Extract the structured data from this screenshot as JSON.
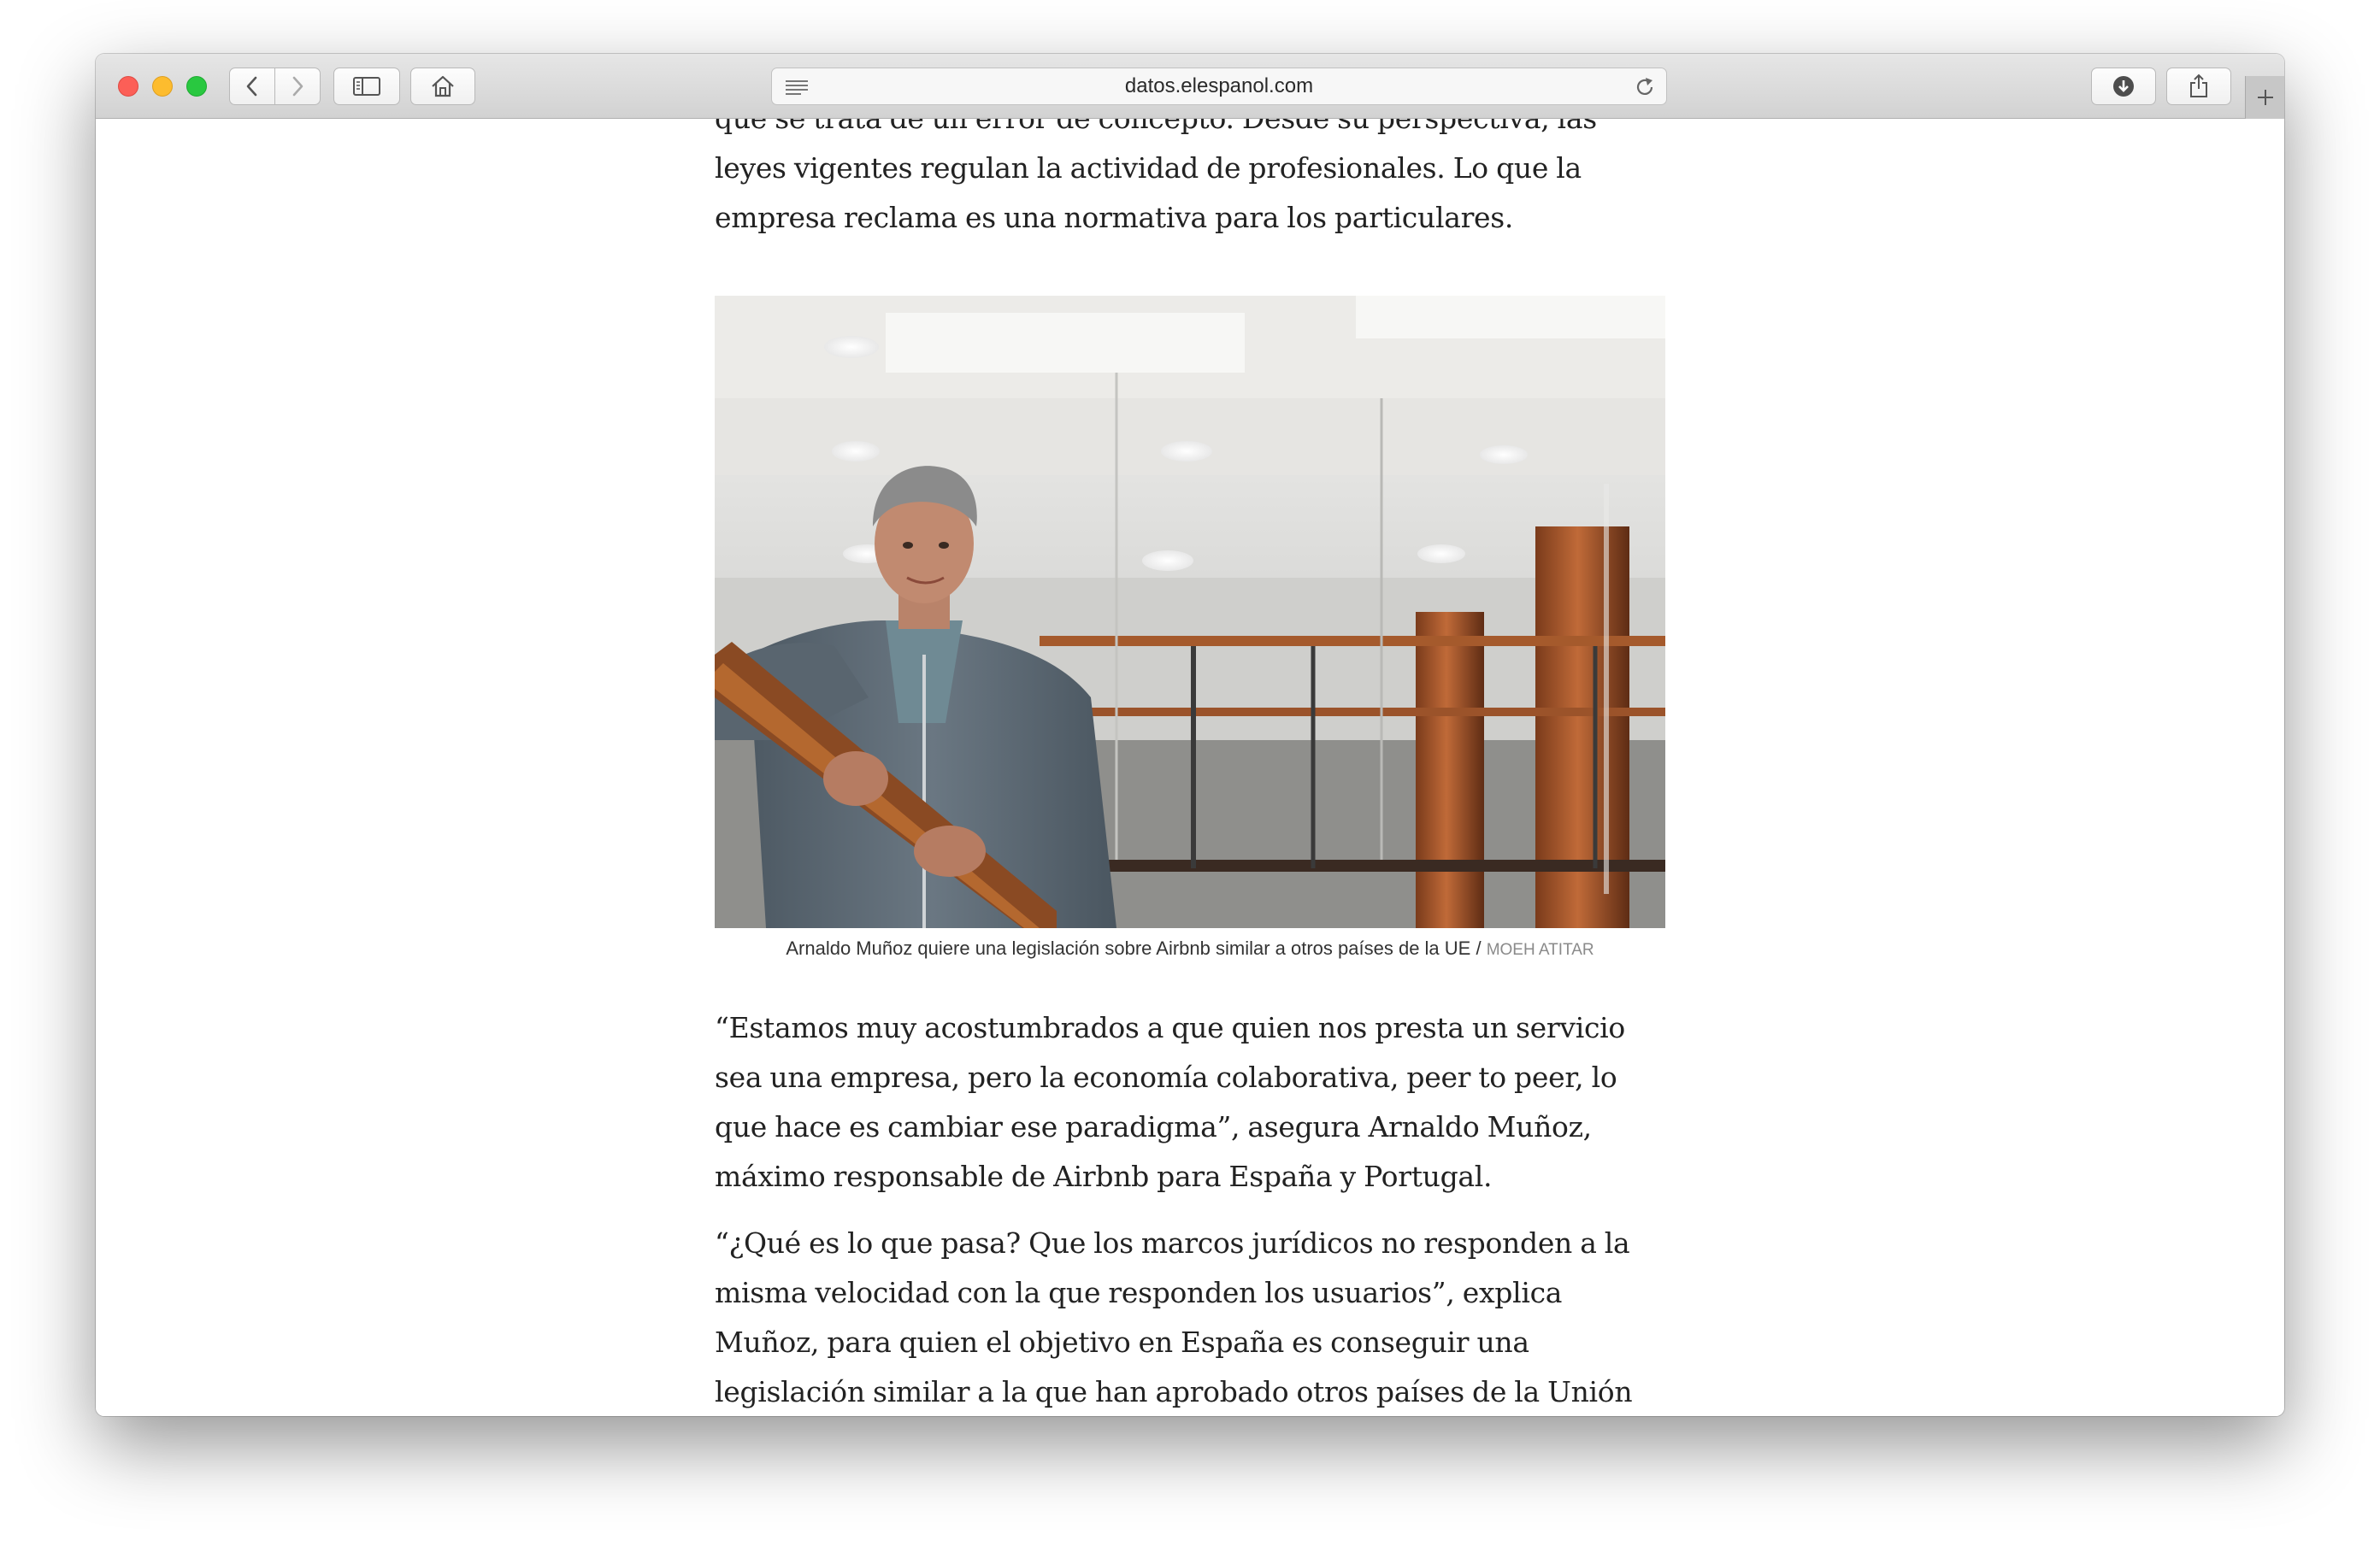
{
  "browser": {
    "url": "datos.elespanol.com",
    "icons": {
      "back": "chevron-left-icon",
      "forward": "chevron-right-icon",
      "sidebar": "sidebar-icon",
      "home": "home-icon",
      "reader": "reader-icon",
      "reload": "reload-icon",
      "download": "download-icon",
      "share": "share-icon",
      "new_tab": "plus-icon"
    }
  },
  "article": {
    "paragraph_top": "que se trata de un error de concepto. Desde su perspectiva, las leyes vigentes regulan la actividad de profesionales. Lo que la empresa reclama es una normativa para los particulares.",
    "figure": {
      "caption": "Arnaldo Muñoz quiere una legislación sobre Airbnb similar a otros países de la UE /",
      "credit": "MOEH ATITAR"
    },
    "paragraph_quote1": "“Estamos muy acostumbrados a que quien nos presta un servicio sea una empresa, pero la economía colaborativa, peer to peer, lo que hace es cambiar ese paradigma”, asegura Arnaldo Muñoz, máximo responsable de Airbnb para España y Portugal.",
    "paragraph_quote2": "“¿Qué es lo que pasa? Que los marcos jurídicos no responden a la misma velocidad con la que responden los usuarios”, explica Muñoz, para quien el objetivo en España es conseguir una legislación similar a la que han aprobado otros países de la Unión"
  }
}
